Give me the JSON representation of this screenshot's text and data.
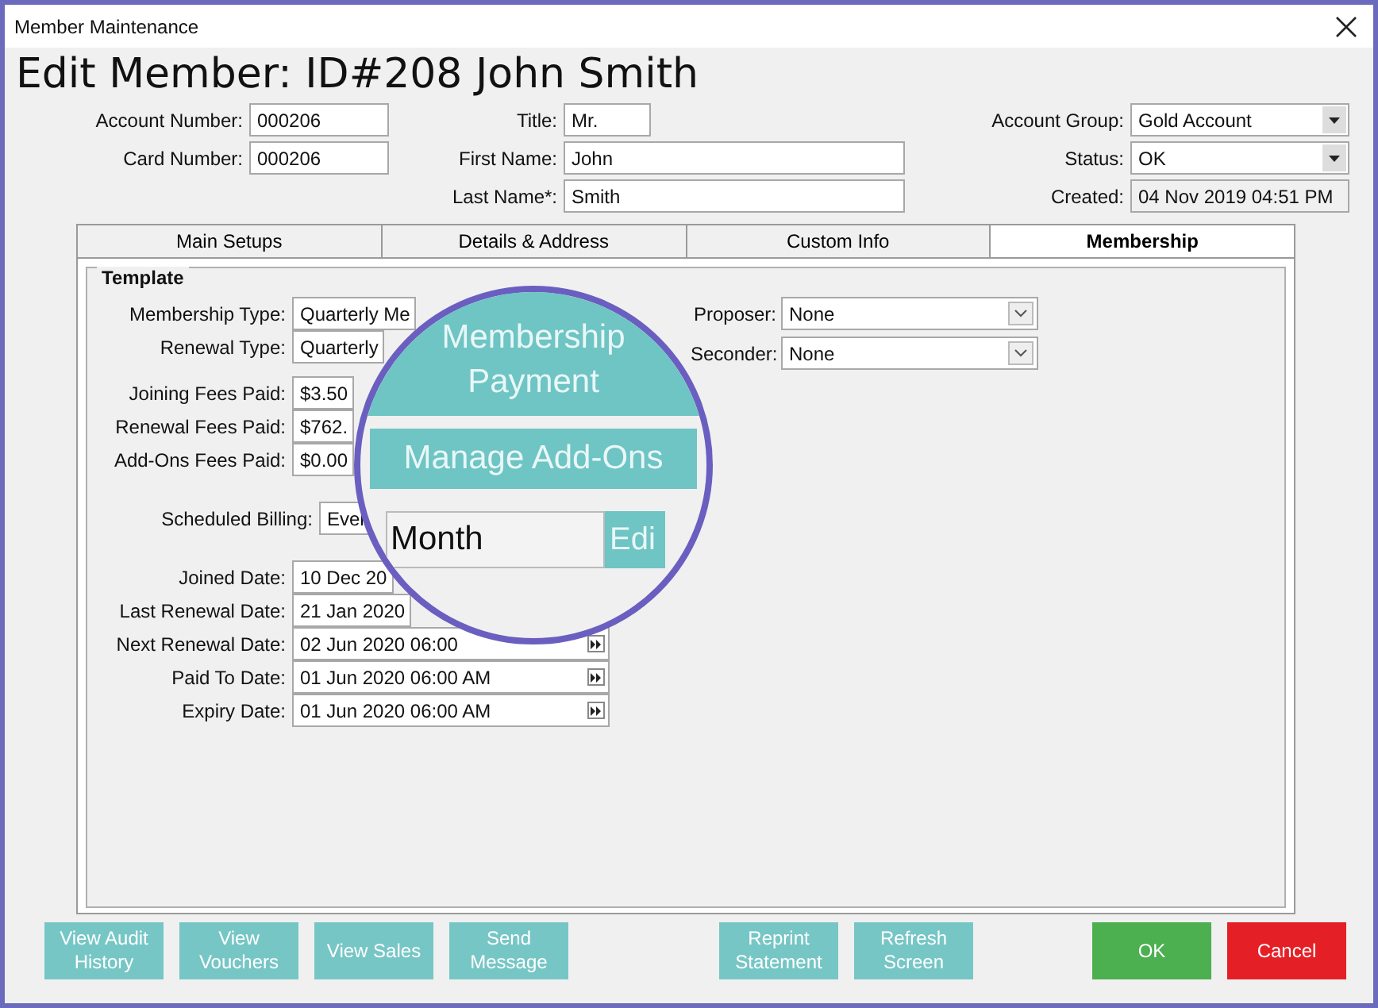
{
  "window": {
    "title": "Member Maintenance"
  },
  "heading": "Edit Member: ID#208 John Smith",
  "header_fields": [
    [
      {
        "label": "Account Number:",
        "value": "000206",
        "kind": "text"
      },
      {
        "label": "Card Number:",
        "value": "000206",
        "kind": "text"
      }
    ],
    [
      {
        "label": "Title:",
        "value": "Mr.",
        "kind": "text"
      },
      {
        "label": "First Name:",
        "value": "John",
        "kind": "text"
      },
      {
        "label": "Last Name*:",
        "value": "Smith",
        "kind": "text"
      }
    ],
    [
      {
        "label": "Account Group:",
        "value": "Gold Account",
        "kind": "select"
      },
      {
        "label": "Status:",
        "value": "OK",
        "kind": "select"
      },
      {
        "label": "Created:",
        "value": "04 Nov 2019 04:51 PM",
        "kind": "readonly"
      }
    ]
  ],
  "tabs": [
    {
      "label": "Main Setups",
      "selected": false
    },
    {
      "label": "Details & Address",
      "selected": false
    },
    {
      "label": "Custom Info",
      "selected": false
    },
    {
      "label": "Membership",
      "selected": true
    }
  ],
  "template": {
    "title": "Template",
    "groups": [
      [
        {
          "label": "Membership Type:",
          "value": "Quarterly Me",
          "kind": "text"
        },
        {
          "label": "Renewal Type:",
          "value": "Quarterly",
          "kind": "text"
        }
      ],
      [
        {
          "label": "Joining Fees Paid:",
          "value": "$3.50",
          "kind": "text"
        },
        {
          "label": "Renewal Fees Paid:",
          "value": "$762.",
          "kind": "text"
        },
        {
          "label": "Add-Ons Fees Paid:",
          "value": "$0.00",
          "kind": "text"
        }
      ],
      [
        {
          "label": "Scheduled Billing:",
          "value": "Ever",
          "kind": "text"
        }
      ],
      [
        {
          "label": "Joined Date:",
          "value": "10 Dec 20",
          "kind": "text"
        },
        {
          "label": "Last Renewal Date:",
          "value": "21 Jan 2020",
          "kind": "text"
        },
        {
          "label": "Next Renewal Date:",
          "value": "02 Jun 2020 06:00",
          "kind": "date"
        },
        {
          "label": "Paid To Date:",
          "value": "01 Jun 2020 06:00 AM",
          "kind": "date"
        },
        {
          "label": "Expiry Date:",
          "value": "01 Jun 2020 06:00 AM",
          "kind": "date"
        }
      ]
    ],
    "sponsors": [
      {
        "label": "Proposer:",
        "value": "None"
      },
      {
        "label": "Seconder:",
        "value": "None"
      }
    ]
  },
  "magnifier": {
    "buttons": [
      "Membership Payment",
      "Manage Add-Ons"
    ],
    "field_value": "Month",
    "edit_button": "Edi"
  },
  "footer_button_groups": [
    [
      {
        "label": "View Audit History",
        "kind": "action"
      },
      {
        "label": "View Vouchers",
        "kind": "action"
      },
      {
        "label": "View Sales",
        "kind": "action"
      },
      {
        "label": "Send Message",
        "kind": "action"
      }
    ],
    [
      {
        "label": "Reprint Statement",
        "kind": "action"
      },
      {
        "label": "Refresh Screen",
        "kind": "action"
      }
    ],
    [
      {
        "label": "OK",
        "kind": "ok"
      },
      {
        "label": "Cancel",
        "kind": "cancel"
      }
    ]
  ]
}
